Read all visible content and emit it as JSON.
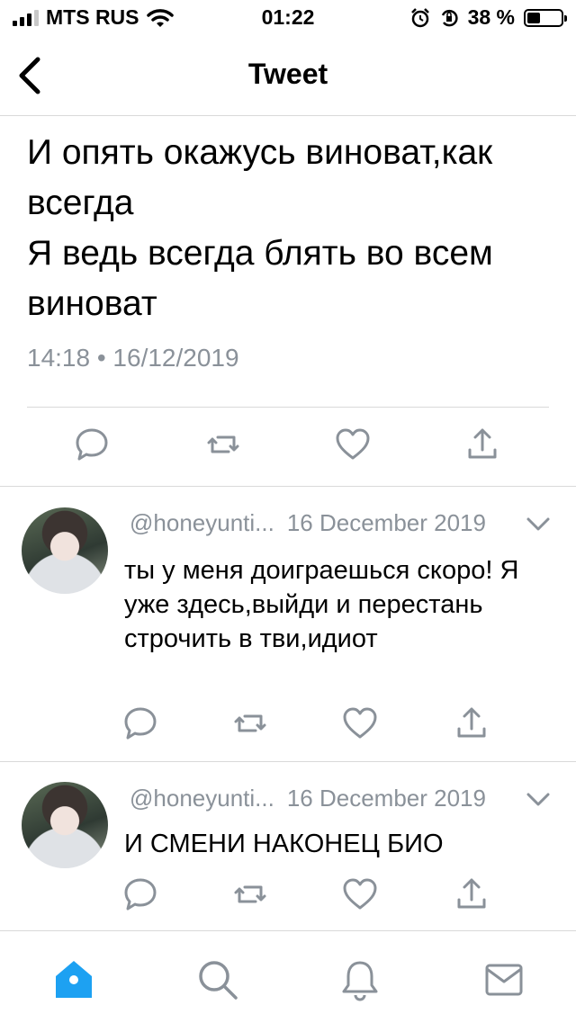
{
  "status_bar": {
    "carrier": "MTS RUS",
    "time": "01:22",
    "battery_percent": "38 %",
    "battery_level": 0.38,
    "icons": [
      "signal-icon",
      "wifi-icon",
      "alarm-icon",
      "rotation-lock-icon",
      "battery-icon"
    ]
  },
  "nav": {
    "title": "Tweet",
    "back_icon": "chevron-left-icon"
  },
  "tweet": {
    "text": "И опять окажусь виноват,как всегда\nЯ ведь всегда блять во всем виноват",
    "meta": "14:18 • 16/12/2019",
    "actions": [
      "reply-icon",
      "retweet-icon",
      "like-icon",
      "share-icon"
    ]
  },
  "replies": [
    {
      "handle": "@honeyunti...",
      "date": "16 December 2019",
      "text": "ты у меня доиграешься скоро! Я уже здесь,выйди и перестань строчить в тви,идиот"
    },
    {
      "handle": "@honeyunti...",
      "date": "16 December 2019",
      "text": "И СМЕНИ НАКОНЕЦ БИО"
    }
  ],
  "tab_bar": {
    "items": [
      "home-icon",
      "search-icon",
      "notifications-icon",
      "messages-icon"
    ],
    "accent": "#1da1f2"
  },
  "colors": {
    "meta_gray": "#8a9199",
    "icon_gray": "#8a9199",
    "divider": "#d9d9d9"
  }
}
